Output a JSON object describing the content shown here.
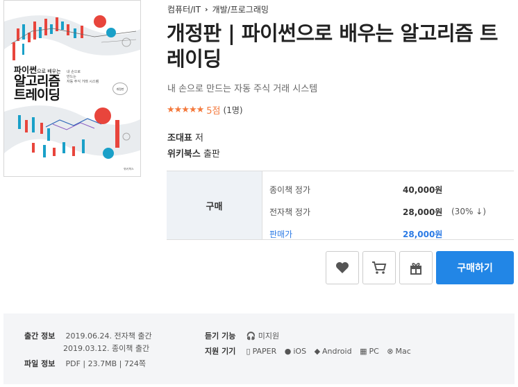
{
  "cover": {
    "title_line1": "파이썬",
    "title_line1_small": "으로 배우는",
    "title_line2": "알고리즘",
    "title_line3": "트레이딩",
    "subtitle_lines": [
      "내 손으로",
      "만드는",
      "자동 주식 거래 시스템"
    ],
    "badge": "개정판",
    "publisher": "위키북스"
  },
  "breadcrumb": {
    "category": "컴퓨터/IT",
    "subcategory": "개발/프로그래밍"
  },
  "book": {
    "title": "개정판 | 파이썬으로 배우는 알고리즘 트레이딩",
    "subtitle": "내 손으로 만드는 자동 주식 거래 시스템",
    "stars": "★★★★★",
    "score": "5점",
    "review_count": "(1명)",
    "author_name": "조대표",
    "author_suffix": " 저",
    "publisher_name": "위키북스",
    "publisher_suffix": " 출판"
  },
  "price": {
    "label": "구매",
    "rows": [
      {
        "key": "종이책 정가",
        "value": "40,000원",
        "discount": ""
      },
      {
        "key": "전자책 정가",
        "value": "28,000원",
        "discount": "(30% ↓)"
      },
      {
        "key": "판매가",
        "value": "28,000원",
        "discount": ""
      }
    ]
  },
  "actions": {
    "buy_label": "구매하기"
  },
  "info": {
    "pub_label": "출간 정보",
    "pub_line1": "2019.06.24. 전자책 출간",
    "pub_line2": "2019.03.12. 종이책 출간",
    "file_label": "파일 정보",
    "file_value": "PDF | 23.7MB | 724쪽",
    "listen_label": "듣기 기능",
    "listen_value": "미지원",
    "device_label": "지원 기기",
    "devices": [
      "PAPER",
      "iOS",
      "Android",
      "PC",
      "Mac"
    ]
  },
  "colors": {
    "accent": "#2286e6",
    "star": "#f4793c",
    "cover_red": "#e8453c",
    "cover_blue": "#1aa0c8"
  }
}
